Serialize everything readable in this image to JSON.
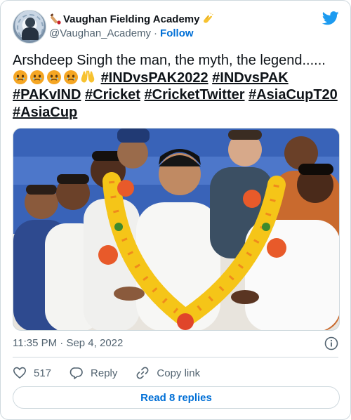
{
  "author": {
    "display_name": "Vaughan Fielding Academy",
    "handle": "@Vaughan_Academy",
    "separator": "·",
    "follow_label": "Follow",
    "avatar_icon": "academy-logo-avatar",
    "name_prefix_icon": "cricket-bat-icon",
    "name_suffix_icon": "clapping-hands-icon"
  },
  "tweet": {
    "text_prefix": "Arshdeep Singh the man, the myth, the legend......",
    "emojis": [
      "face-holding-back-tears",
      "face-holding-back-tears",
      "face-holding-back-tears",
      "face-holding-back-tears",
      "raising-hands"
    ],
    "hashtags": [
      "#INDvsPAK2022",
      "#INDvsPAK",
      "#PAKvIND",
      "#Cricket",
      "#CricketTwitter",
      "#AsiaCupT20",
      "#AsiaCup"
    ]
  },
  "meta": {
    "time": "11:35 PM",
    "separator": "·",
    "date": "Sep 4, 2022"
  },
  "actions": {
    "like_count": "517",
    "reply_label": "Reply",
    "copy_link_label": "Copy link"
  },
  "footer": {
    "read_replies_label": "Read 8 replies"
  },
  "colors": {
    "link_blue": "#006fd6",
    "twitter_blue": "#1d9bf0",
    "muted_text": "#536471",
    "border": "#cfd9de",
    "text": "#0f1419"
  }
}
